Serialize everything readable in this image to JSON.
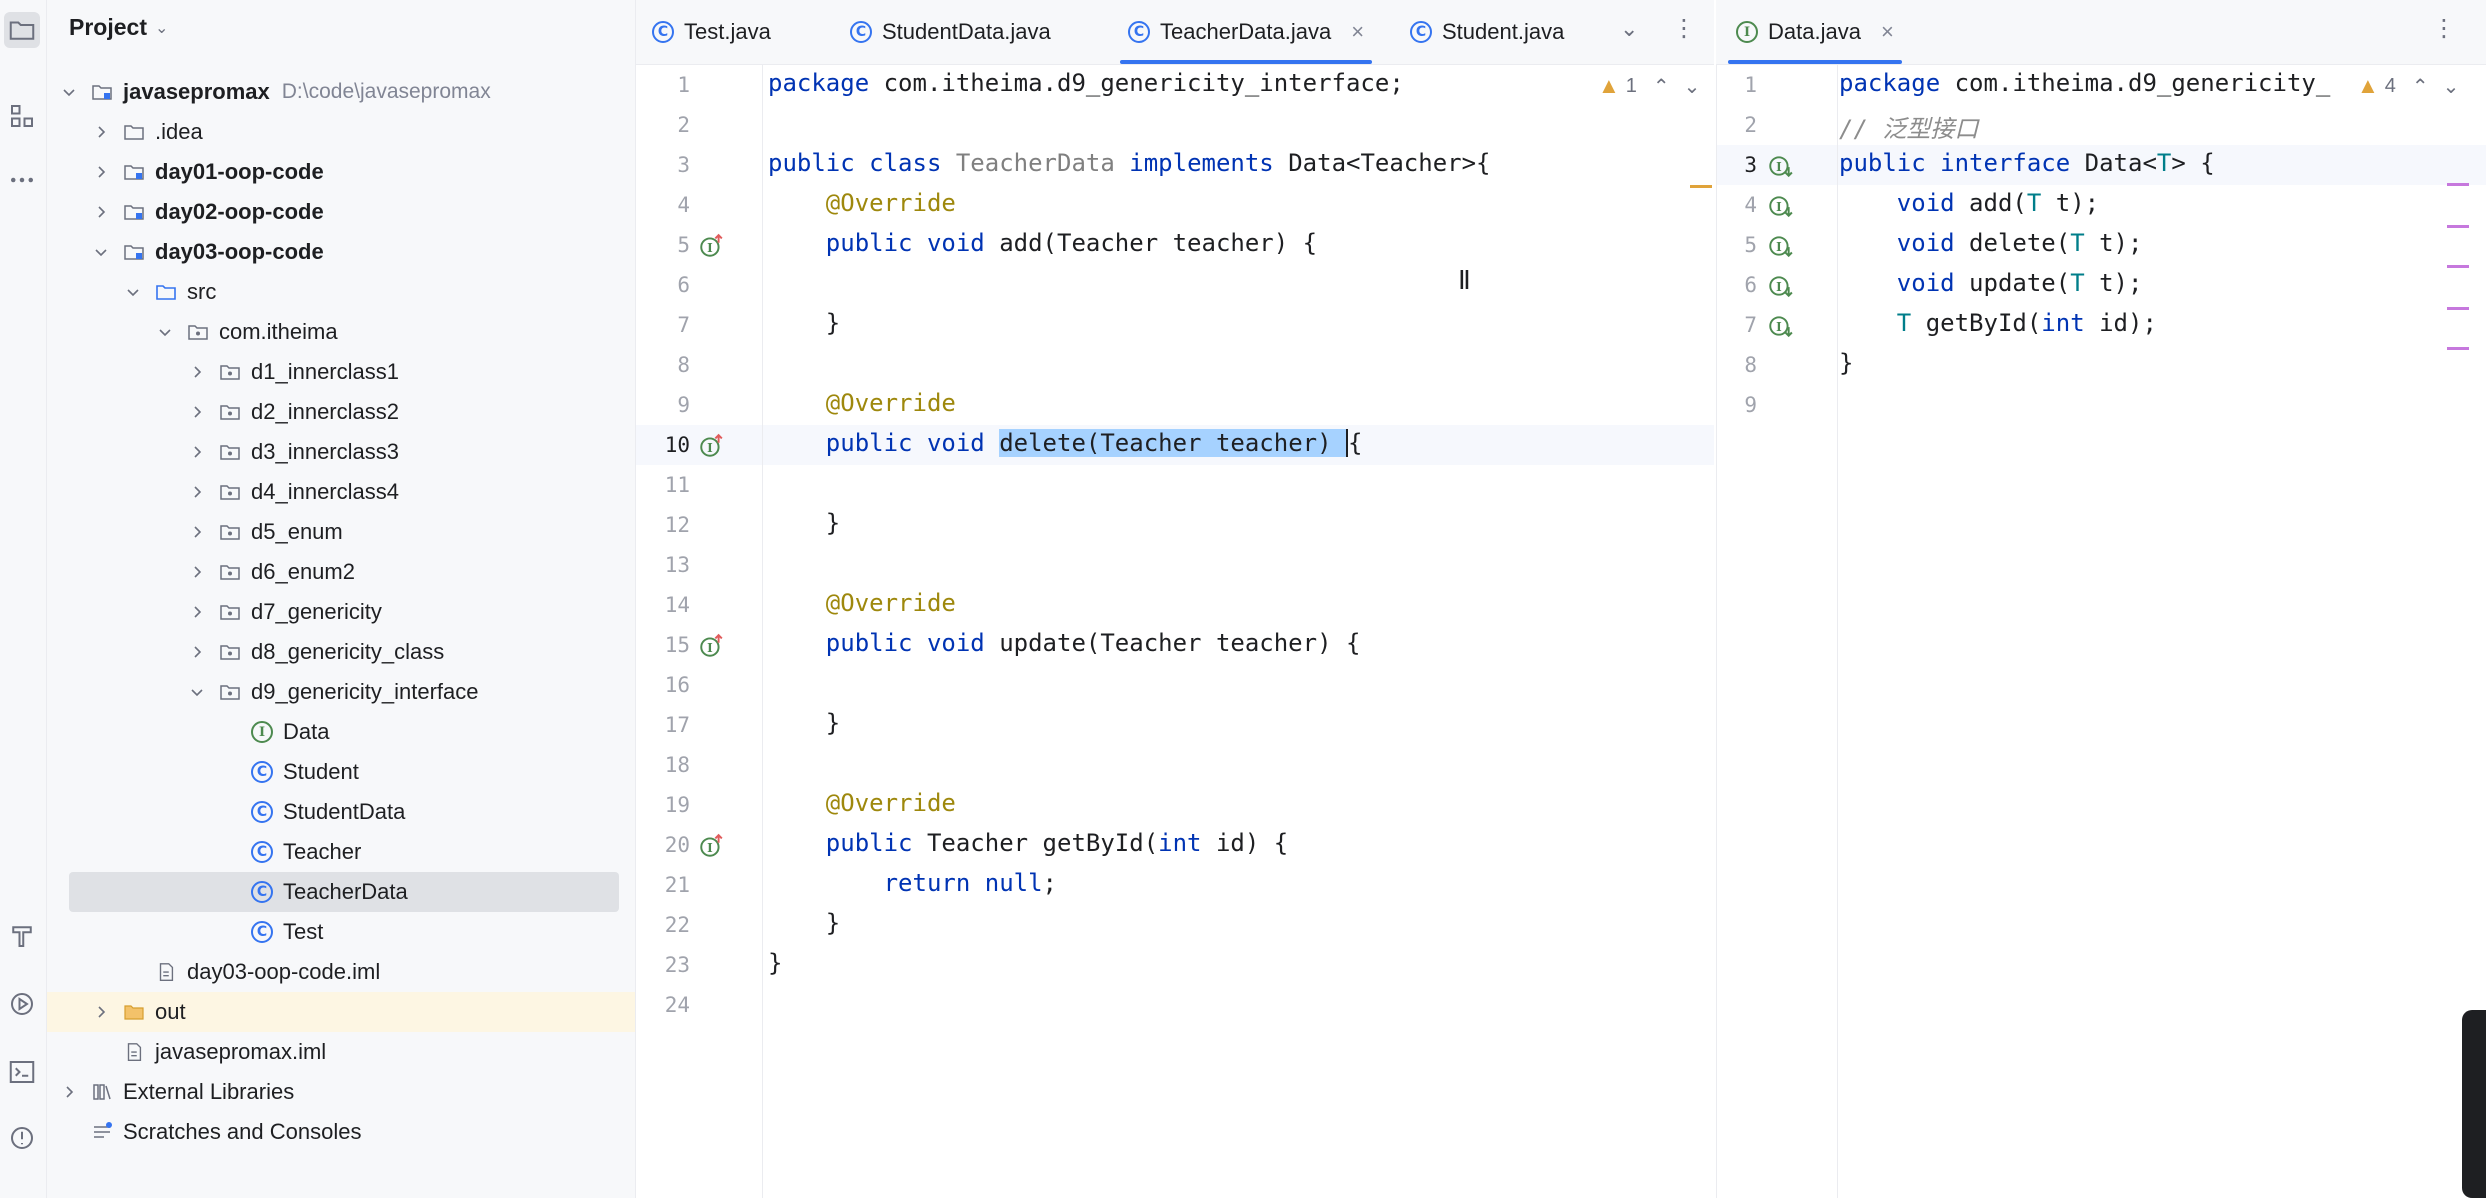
{
  "project_panel": {
    "title": "Project",
    "tree": [
      {
        "label": "javasepromax",
        "path": "D:\\code\\javasepromax",
        "bold": true,
        "depth": 0,
        "expanded": true,
        "icon": "module-folder-icon"
      },
      {
        "label": ".idea",
        "depth": 1,
        "expanded": false,
        "icon": "folder-icon"
      },
      {
        "label": "day01-oop-code",
        "bold": true,
        "depth": 1,
        "expanded": false,
        "icon": "module-folder-icon"
      },
      {
        "label": "day02-oop-code",
        "bold": true,
        "depth": 1,
        "expanded": false,
        "icon": "module-folder-icon"
      },
      {
        "label": "day03-oop-code",
        "bold": true,
        "depth": 1,
        "expanded": true,
        "icon": "module-folder-icon"
      },
      {
        "label": "src",
        "depth": 2,
        "expanded": true,
        "icon": "source-folder-icon"
      },
      {
        "label": "com.itheima",
        "depth": 3,
        "expanded": true,
        "icon": "package-icon"
      },
      {
        "label": "d1_innerclass1",
        "depth": 4,
        "expanded": false,
        "icon": "package-icon"
      },
      {
        "label": "d2_innerclass2",
        "depth": 4,
        "expanded": false,
        "icon": "package-icon"
      },
      {
        "label": "d3_innerclass3",
        "depth": 4,
        "expanded": false,
        "icon": "package-icon"
      },
      {
        "label": "d4_innerclass4",
        "depth": 4,
        "expanded": false,
        "icon": "package-icon"
      },
      {
        "label": "d5_enum",
        "depth": 4,
        "expanded": false,
        "icon": "package-icon"
      },
      {
        "label": "d6_enum2",
        "depth": 4,
        "expanded": false,
        "icon": "package-icon"
      },
      {
        "label": "d7_genericity",
        "depth": 4,
        "expanded": false,
        "icon": "package-icon"
      },
      {
        "label": "d8_genericity_class",
        "depth": 4,
        "expanded": false,
        "icon": "package-icon"
      },
      {
        "label": "d9_genericity_interface",
        "depth": 4,
        "expanded": true,
        "icon": "package-icon"
      },
      {
        "label": "Data",
        "depth": 5,
        "icon": "interface-icon"
      },
      {
        "label": "Student",
        "depth": 5,
        "icon": "class-icon"
      },
      {
        "label": "StudentData",
        "depth": 5,
        "icon": "class-icon"
      },
      {
        "label": "Teacher",
        "depth": 5,
        "icon": "class-icon"
      },
      {
        "label": "TeacherData",
        "depth": 5,
        "icon": "class-icon",
        "selected": true
      },
      {
        "label": "Test",
        "depth": 5,
        "icon": "class-icon"
      },
      {
        "label": "day03-oop-code.iml",
        "depth": 2,
        "icon": "iml-file-icon"
      },
      {
        "label": "out",
        "depth": 1,
        "expanded": false,
        "icon": "excluded-folder-icon",
        "highlight": true
      },
      {
        "label": "javasepromax.iml",
        "depth": 1,
        "icon": "iml-file-icon"
      },
      {
        "label": "External Libraries",
        "depth": 0,
        "expanded": false,
        "icon": "libraries-icon"
      },
      {
        "label": "Scratches and Consoles",
        "depth": 0,
        "icon": "scratches-icon"
      }
    ]
  },
  "tabs_left": [
    {
      "label": "Test.java",
      "icon": "class-icon"
    },
    {
      "label": "StudentData.java",
      "icon": "class-icon"
    },
    {
      "label": "TeacherData.java",
      "icon": "class-icon",
      "active": true,
      "closable": true
    },
    {
      "label": "Student.java",
      "icon": "class-icon"
    }
  ],
  "tabs_right": [
    {
      "label": "Data.java",
      "icon": "interface-icon",
      "active": true,
      "closable": true
    }
  ],
  "editor_left": {
    "warnings": "1",
    "line_numbers": [
      "1",
      "2",
      "3",
      "4",
      "5",
      "6",
      "7",
      "8",
      "9",
      "10",
      "11",
      "12",
      "13",
      "14",
      "15",
      "16",
      "17",
      "18",
      "19",
      "20",
      "21",
      "22",
      "23",
      "24"
    ],
    "lines": [
      "package com.itheima.d9_genericity_interface;",
      "",
      "public class TeacherData implements Data<Teacher>{",
      "    @Override",
      "    public void add(Teacher teacher) {",
      "",
      "    }",
      "",
      "    @Override",
      "    public void delete(Teacher teacher) {",
      "",
      "    }",
      "",
      "    @Override",
      "    public void update(Teacher teacher) {",
      "",
      "    }",
      "",
      "    @Override",
      "    public Teacher getById(int id) {",
      "        return null;",
      "    }",
      "}",
      ""
    ]
  },
  "editor_right": {
    "warnings": "4",
    "line_numbers": [
      "1",
      "2",
      "3",
      "4",
      "5",
      "6",
      "7",
      "8",
      "9"
    ],
    "lines": [
      "package com.itheima.d9_genericity_",
      "// 泛型接口",
      "public interface Data<T> {",
      "    void add(T t);",
      "    void delete(T t);",
      "    void update(T t);",
      "    T getById(int id);",
      "}",
      ""
    ]
  },
  "colors": {
    "accent": "#3574f0",
    "keyword": "#0033b3",
    "annotation": "#9e880d",
    "selection": "#a6d2ff",
    "implemented_icon": "#4d8a4f"
  }
}
